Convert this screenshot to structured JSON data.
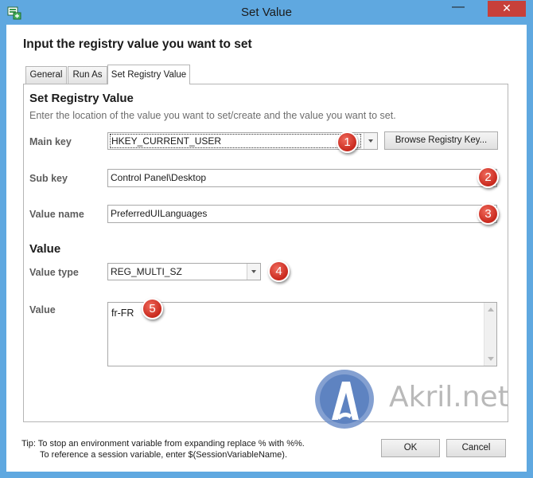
{
  "window": {
    "title": "Set Value",
    "minimize_glyph": "—",
    "close_glyph": "✕",
    "frame_color": "#5fa8e0",
    "close_color": "#c7403a"
  },
  "dialog": {
    "heading": "Input the registry value you want to set",
    "tabs": [
      {
        "label": "General"
      },
      {
        "label": "Run As"
      },
      {
        "label": "Set Registry Value"
      }
    ]
  },
  "registry": {
    "section_title": "Set Registry Value",
    "description": "Enter the location of the value you want to set/create and the value you want to set.",
    "main_key_label": "Main key",
    "main_key_value": "HKEY_CURRENT_USER",
    "browse_label": "Browse Registry Key...",
    "sub_key_label": "Sub key",
    "sub_key_value": "Control Panel\\Desktop",
    "value_name_label": "Value name",
    "value_name_value": "PreferredUILanguages"
  },
  "value_section": {
    "title": "Value",
    "value_type_label": "Value type",
    "value_type_value": "REG_MULTI_SZ",
    "value_label": "Value",
    "value_text": "fr-FR"
  },
  "badges": [
    "1",
    "2",
    "3",
    "4",
    "5"
  ],
  "tip": {
    "line1": "Tip: To stop an environment variable from expanding replace % with %%.",
    "line2": "To reference a session variable, enter $(SessionVariableName)."
  },
  "buttons": {
    "ok": "OK",
    "cancel": "Cancel"
  },
  "watermark": {
    "text": "Akril.net",
    "icon": "akril-logo-icon"
  }
}
